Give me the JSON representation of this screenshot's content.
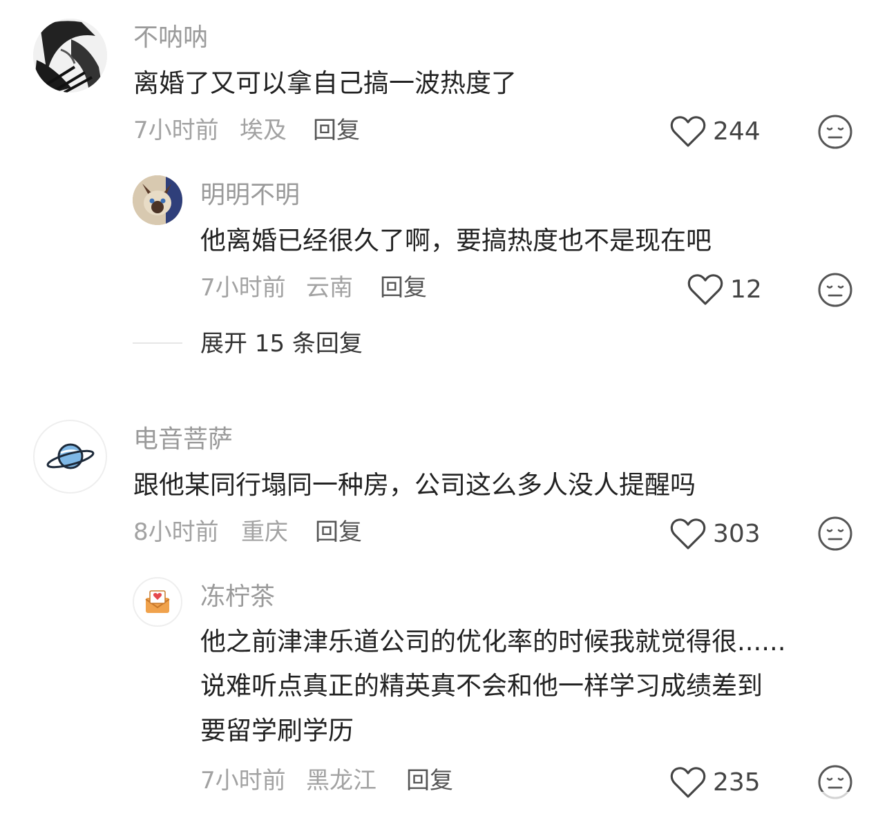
{
  "comments": [
    {
      "username": "不呐呐",
      "text": "离婚了又可以拿自己搞一波热度了",
      "time": "7小时前",
      "location": "埃及",
      "reply_label": "回复",
      "likes": "244",
      "replies": [
        {
          "username": "明明不明",
          "text": "他离婚已经很久了啊，要搞热度也不是现在吧",
          "time": "7小时前",
          "location": "云南",
          "reply_label": "回复",
          "likes": "12"
        }
      ],
      "expand_label": "展开 15 条回复"
    },
    {
      "username": "电音菩萨",
      "text": "跟他某同行塌同一种房，公司这么多人没人提醒吗",
      "time": "8小时前",
      "location": "重庆",
      "reply_label": "回复",
      "likes": "303",
      "replies": [
        {
          "username": "冻柠茶",
          "text_lines": [
            "他之前津津乐道公司的优化率的时候我就觉得很......",
            "说难听点真正的精英真不会和他一样学习成绩差到",
            "要留学刷学历"
          ],
          "time": "7小时前",
          "location": "黑龙江",
          "reply_label": "回复",
          "likes": "235"
        }
      ]
    }
  ],
  "icons": {
    "like": "heart-outline-icon",
    "dislike": "meh-face-icon"
  }
}
